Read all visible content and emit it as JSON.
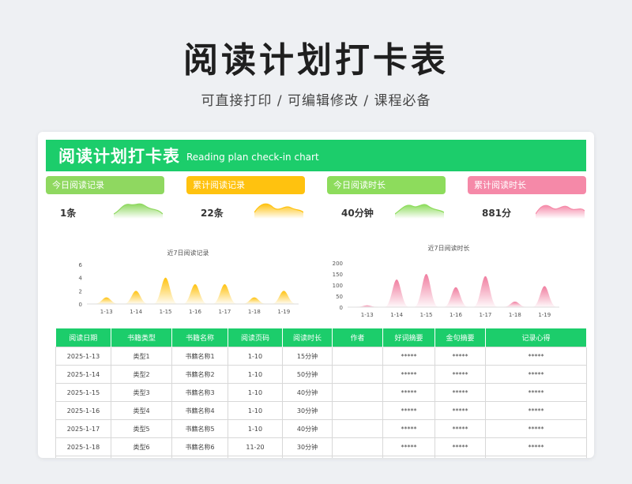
{
  "page": {
    "title": "阅读计划打卡表",
    "subtitle": "可直接打印 /  可编辑修改  /  课程必备"
  },
  "banner": {
    "title": "阅读计划打卡表",
    "title_en": "Reading plan check-in chart"
  },
  "stats": [
    {
      "label": "今日阅读记录",
      "value": "1条",
      "color": "#8fd860"
    },
    {
      "label": "累计阅读记录",
      "value": "22条",
      "color": "#ffc20f"
    },
    {
      "label": "今日阅读时长",
      "value": "40分钟",
      "color": "#8ddc5c"
    },
    {
      "label": "累计阅读时长",
      "value": "881分",
      "color": "#f589a8"
    }
  ],
  "chart_data": [
    {
      "type": "area",
      "title": "近7日阅读记录",
      "categories": [
        "1-13",
        "1-14",
        "1-15",
        "1-16",
        "1-17",
        "1-18",
        "1-19"
      ],
      "values": [
        1,
        2,
        4,
        3,
        3,
        1,
        2
      ],
      "ylim": [
        0,
        6
      ],
      "yticks": [
        "0",
        "2",
        "4",
        "6"
      ],
      "color": "#ffc20f"
    },
    {
      "type": "area",
      "title": "近7日阅读时长",
      "categories": [
        "1-13",
        "1-14",
        "1-15",
        "1-16",
        "1-17",
        "1-18",
        "1-19"
      ],
      "values": [
        8,
        125,
        150,
        90,
        140,
        25,
        95
      ],
      "ylim": [
        0,
        200
      ],
      "yticks": [
        "0",
        "50",
        "100",
        "150",
        "200"
      ],
      "color": "#f07ea0"
    }
  ],
  "table": {
    "headers": [
      "阅读日期",
      "书籍类型",
      "书籍名称",
      "阅读页码",
      "阅读时长",
      "作者",
      "好词摘要",
      "金句摘要",
      "记录心得"
    ],
    "rows": [
      [
        "2025-1-13",
        "类型1",
        "书籍名称1",
        "1-10",
        "15分钟",
        "",
        "*****",
        "*****",
        "*****"
      ],
      [
        "2025-1-14",
        "类型2",
        "书籍名称2",
        "1-10",
        "50分钟",
        "",
        "*****",
        "*****",
        "*****"
      ],
      [
        "2025-1-15",
        "类型3",
        "书籍名称3",
        "1-10",
        "40分钟",
        "",
        "*****",
        "*****",
        "*****"
      ],
      [
        "2025-1-16",
        "类型4",
        "书籍名称4",
        "1-10",
        "30分钟",
        "",
        "*****",
        "*****",
        "*****"
      ],
      [
        "2025-1-17",
        "类型5",
        "书籍名称5",
        "1-10",
        "40分钟",
        "",
        "*****",
        "*****",
        "*****"
      ],
      [
        "2025-1-18",
        "类型6",
        "书籍名称6",
        "11-20",
        "30分钟",
        "",
        "*****",
        "*****",
        "*****"
      ],
      [
        "2025-1-19",
        "类型7",
        "书籍名称7",
        "11-20",
        "50分钟",
        "",
        "*****",
        "*****",
        "*****"
      ]
    ]
  }
}
